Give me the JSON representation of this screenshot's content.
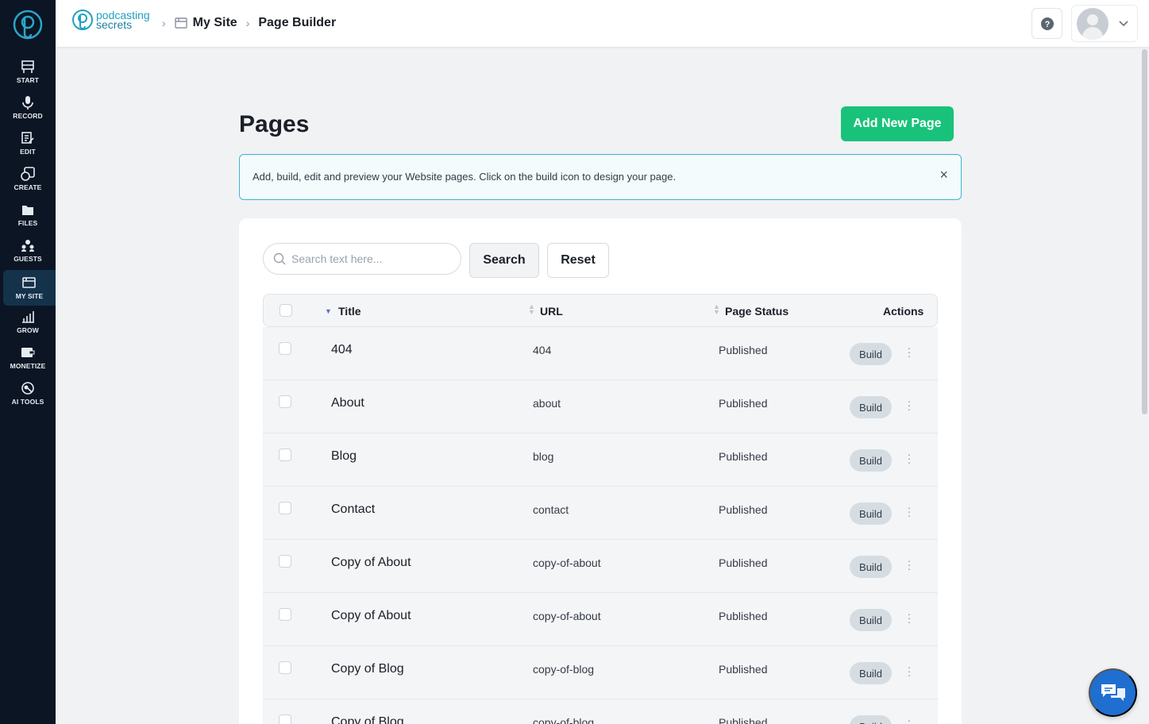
{
  "sidebar": {
    "items": [
      {
        "label": "START",
        "icon": "start-icon"
      },
      {
        "label": "RECORD",
        "icon": "microphone-icon"
      },
      {
        "label": "EDIT",
        "icon": "edit-icon"
      },
      {
        "label": "CREATE",
        "icon": "create-icon"
      },
      {
        "label": "FILES",
        "icon": "files-icon"
      },
      {
        "label": "GUESTS",
        "icon": "guests-icon"
      },
      {
        "label": "MY SITE",
        "icon": "site-icon",
        "active": true
      },
      {
        "label": "GROW",
        "icon": "chart-icon"
      },
      {
        "label": "MONETIZE",
        "icon": "monetize-icon"
      },
      {
        "label": "AI TOOLS",
        "icon": "ai-tools-icon"
      }
    ]
  },
  "header": {
    "brand_line1": "podcasting",
    "brand_line2": "secrets",
    "breadcrumb": [
      "My Site",
      "Page Builder"
    ]
  },
  "main": {
    "title": "Pages",
    "add_button": "Add New Page",
    "info_text": "Add, build, edit and preview your Website pages. Click on the build icon to design your page.",
    "info_close": "×",
    "search_placeholder": "Search text here...",
    "search_button": "Search",
    "reset_button": "Reset"
  },
  "table": {
    "columns": {
      "title": "Title",
      "url": "URL",
      "status": "Page Status",
      "actions": "Actions"
    },
    "build_label": "Build",
    "rows": [
      {
        "title": "404",
        "url": "404",
        "status": "Published"
      },
      {
        "title": "About",
        "url": "about",
        "status": "Published"
      },
      {
        "title": "Blog",
        "url": "blog",
        "status": "Published"
      },
      {
        "title": "Contact",
        "url": "contact",
        "status": "Published"
      },
      {
        "title": "Copy of About",
        "url": "copy-of-about",
        "status": "Published"
      },
      {
        "title": "Copy of About",
        "url": "copy-of-about",
        "status": "Published"
      },
      {
        "title": "Copy of Blog",
        "url": "copy-of-blog",
        "status": "Published"
      },
      {
        "title": "Copy of Blog",
        "url": "copy-of-blog",
        "status": "Published"
      }
    ]
  },
  "colors": {
    "sidebar_bg": "#0b1523",
    "accent_green": "#18c27a",
    "brand_teal": "#21a0c2",
    "chat_blue": "#1f6fd1"
  }
}
